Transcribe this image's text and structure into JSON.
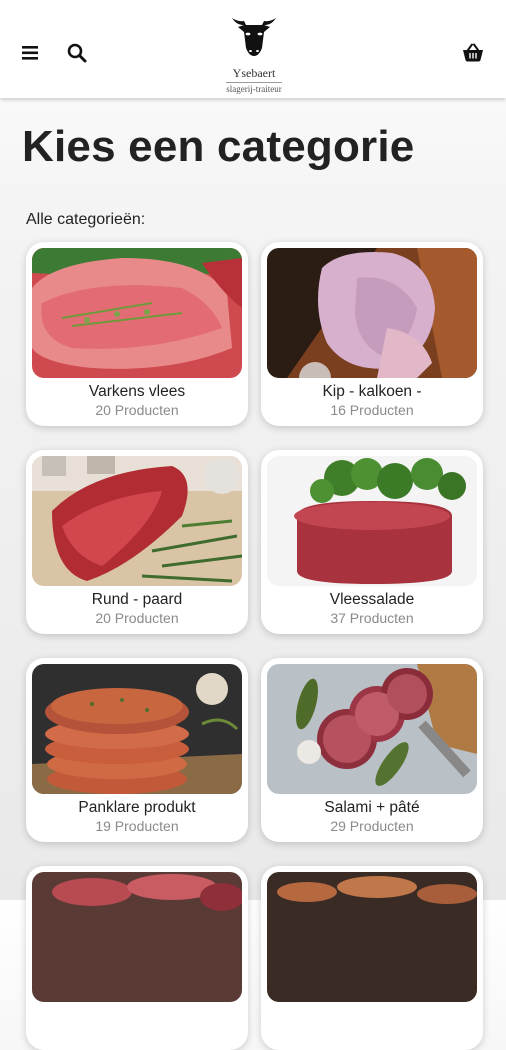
{
  "header": {
    "logo_name": "Ysebaert",
    "logo_sub": "slagerij-traiteur",
    "menu_icon": "hamburger-menu-icon",
    "search_icon": "search-icon",
    "cart_icon": "basket-icon"
  },
  "page": {
    "title": "Kies een categorie",
    "subtitle": "Alle categorieën:"
  },
  "categories": [
    {
      "label": "Varkens vlees",
      "count": "20 Producten",
      "image": "raw-pork-steak"
    },
    {
      "label": "Kip - kalkoen -",
      "count": "16 Producten",
      "image": "raw-chicken"
    },
    {
      "label": "Rund - paard",
      "count": "20 Producten",
      "image": "raw-beef-with-herbs"
    },
    {
      "label": "Vleessalade",
      "count": "37 Producten",
      "image": "steak-tartare-with-parsley"
    },
    {
      "label": "Panklare produkt",
      "count": "19 Producten",
      "image": "burger-patties"
    },
    {
      "label": "Salami + pâté",
      "count": "29 Producten",
      "image": "salami-with-pickles"
    },
    {
      "label": "",
      "count": "",
      "image": "cured-meats"
    },
    {
      "label": "",
      "count": "",
      "image": "sausages"
    }
  ]
}
